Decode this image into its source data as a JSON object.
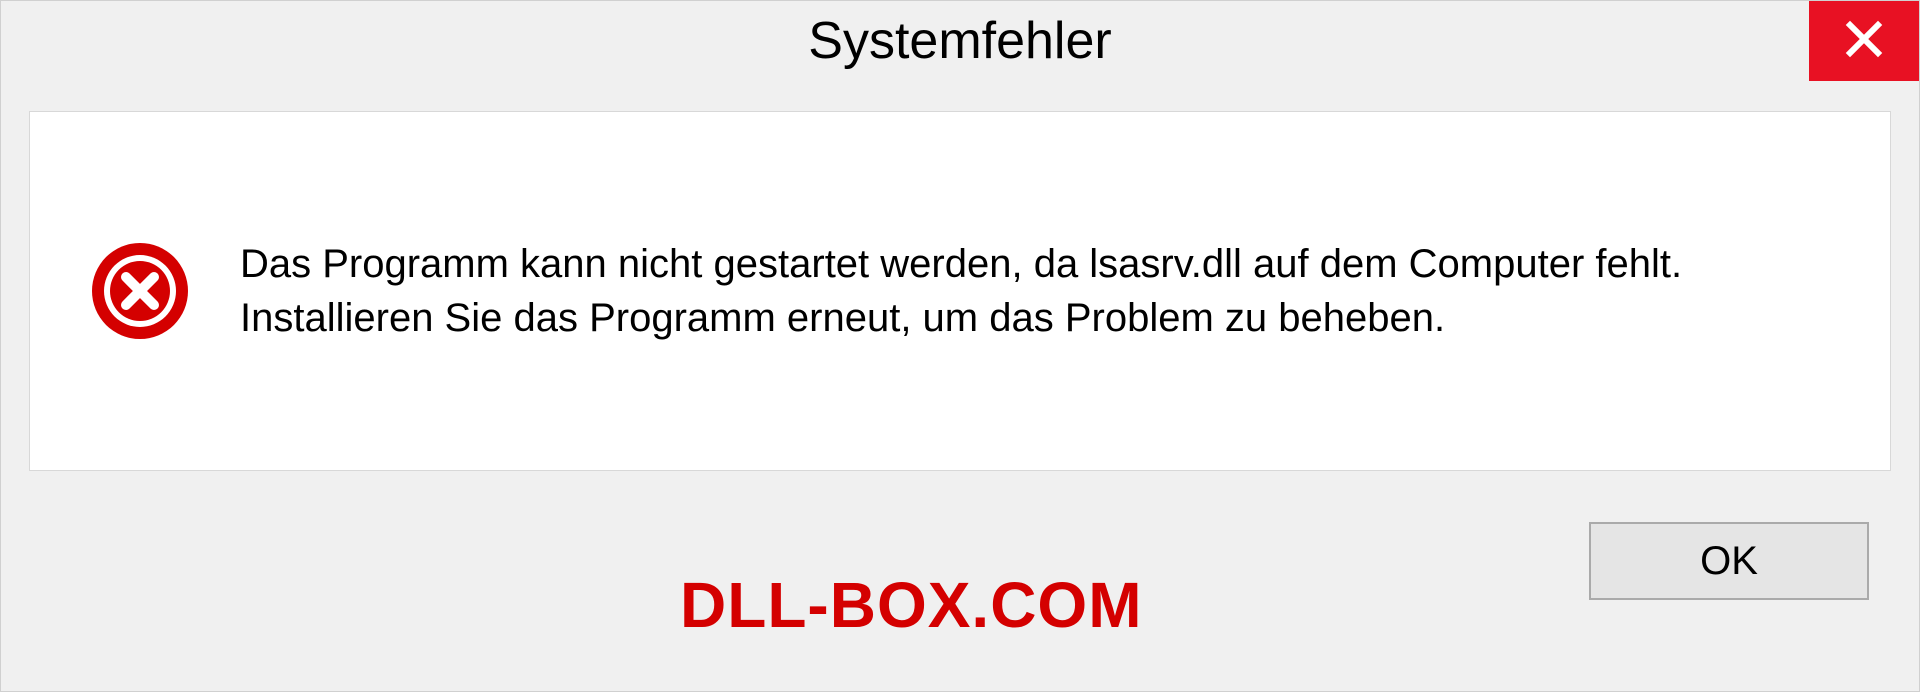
{
  "dialog": {
    "title": "Systemfehler",
    "message": "Das Programm kann nicht gestartet werden, da lsasrv.dll auf dem Computer fehlt. Installieren Sie das Programm erneut, um das Problem zu beheben.",
    "ok_label": "OK"
  },
  "watermark": "DLL-BOX.COM",
  "colors": {
    "close_bg": "#e81123",
    "error_icon": "#d40000",
    "watermark": "#d40000"
  }
}
